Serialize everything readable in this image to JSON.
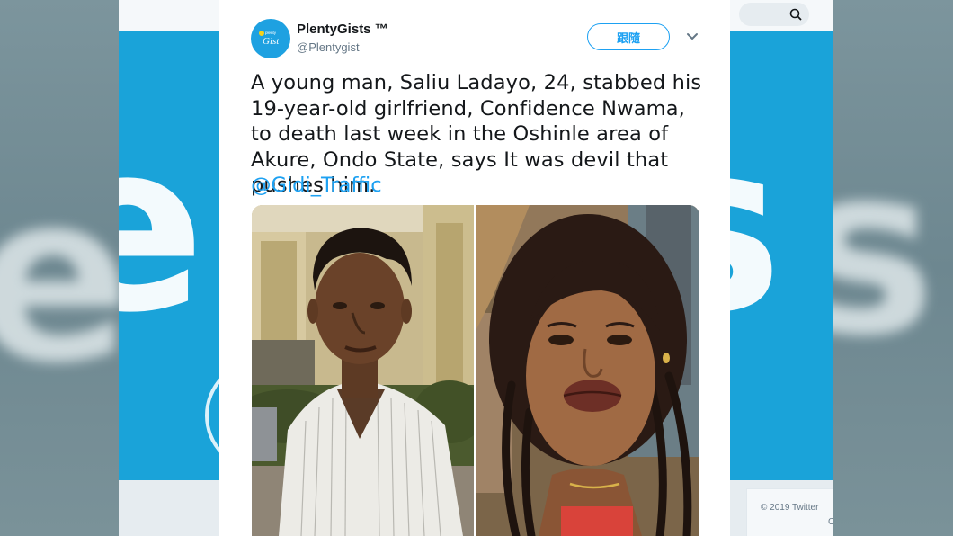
{
  "background": {
    "banner_text": "enGis",
    "side_left_text": "e",
    "side_right_text": "s",
    "footer": {
      "copyright": "© 2019 Twitter",
      "extra": "C"
    },
    "colors": {
      "banner": "#1aa3d9",
      "side": "#6f8a93"
    }
  },
  "tweet": {
    "author": {
      "display_name": "PlentyGists ™",
      "handle": "@Plentygist",
      "avatar_text": "Gist",
      "avatar_small_text": "plenty"
    },
    "follow_label": "跟隨",
    "text": "A young man, Saliu Ladayo, 24, stabbed his 19-year-old girlfriend, Confidence Nwama, to death last week in the Oshinle area of Akure, Ondo State, says It was devil that pushes him.",
    "mention": "@Gidi_Traffic",
    "colors": {
      "accent": "#1da1f2",
      "text": "#14171a",
      "muted": "#657786"
    }
  },
  "icons": {
    "caret": "chevron-down-icon",
    "search": "search-icon"
  }
}
